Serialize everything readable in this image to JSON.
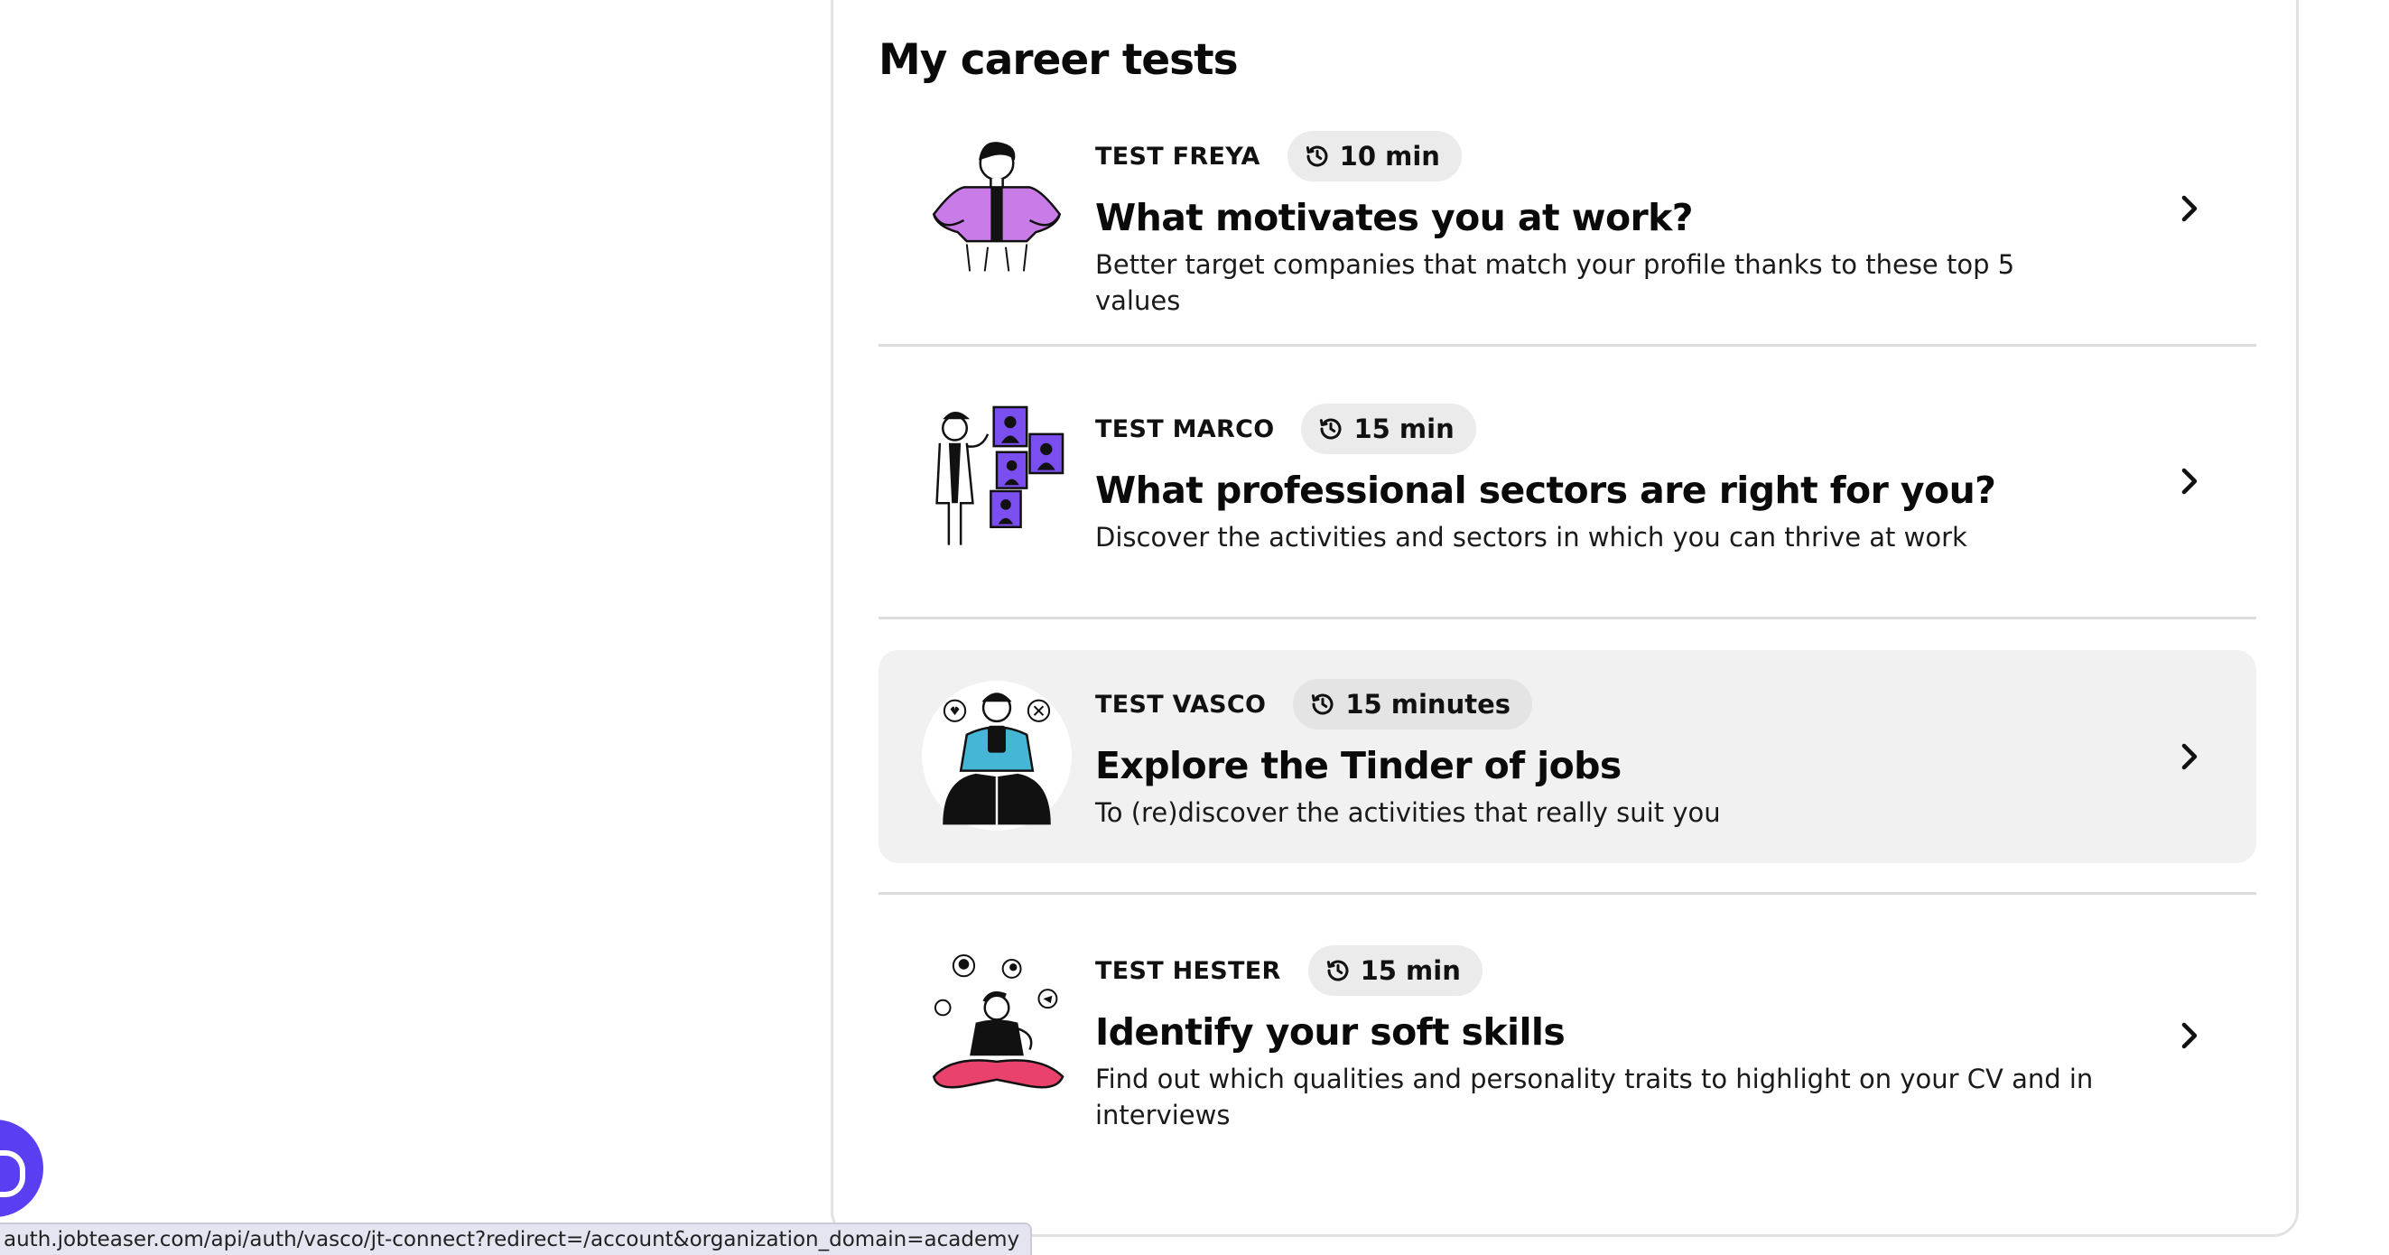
{
  "section": {
    "title": "My career tests"
  },
  "tests": [
    {
      "name": "TEST FREYA",
      "duration": "10 min",
      "headline": "What motivates you at work?",
      "description": "Better target companies that match your profile thanks to these top 5 values",
      "illustration_icon": "woman-hands-on-hips-icon",
      "highlighted": false
    },
    {
      "name": "TEST MARCO",
      "duration": "15 min",
      "headline": "What professional sectors are right for you?",
      "description": "Discover the activities and sectors in which you can thrive at work",
      "illustration_icon": "man-with-portraits-icon",
      "highlighted": false
    },
    {
      "name": "TEST VASCO",
      "duration": "15 minutes",
      "headline": "Explore the Tinder of jobs",
      "description": "To (re)discover the activities that really suit you",
      "illustration_icon": "person-swiping-phone-icon",
      "highlighted": true
    },
    {
      "name": "TEST HESTER",
      "duration": "15 min",
      "headline": "Identify your soft skills",
      "description": "Find out which qualities and personality traits to highlight on your CV and in interviews",
      "illustration_icon": "person-meditating-icon",
      "highlighted": false
    }
  ],
  "icons": {
    "duration": "history-clock-icon",
    "row_action": "chevron-right-icon",
    "help": "chat-help-icon"
  },
  "colors": {
    "accent_purple": "#c97be8",
    "accent_violet": "#7b4ef0",
    "accent_teal": "#46b6d6",
    "accent_pink": "#e8426d",
    "help_bubble": "#5a3ff2",
    "highlight_row": "#f1f1f1"
  },
  "status_bar": {
    "url": "auth.jobteaser.com/api/auth/vasco/jt-connect?redirect=/account&organization_domain=academy"
  }
}
